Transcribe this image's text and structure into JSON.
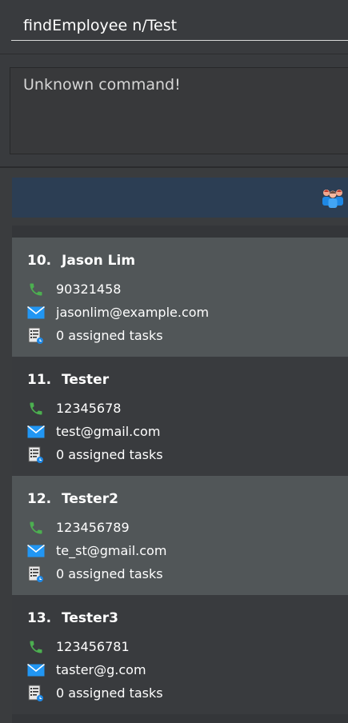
{
  "command_box": {
    "value": "findEmployee n/Test"
  },
  "result_display": {
    "text": "Unknown command!"
  },
  "list_header": {
    "icon": "team-icon"
  },
  "employees": [
    {
      "index": "10.",
      "name": "Jason Lim",
      "phone": "90321458",
      "email": "jasonlim@example.com",
      "tasks": "0 assigned tasks"
    },
    {
      "index": "11.",
      "name": "Tester",
      "phone": "12345678",
      "email": "test@gmail.com",
      "tasks": "0 assigned tasks"
    },
    {
      "index": "12.",
      "name": "Tester2",
      "phone": "123456789",
      "email": "te_st@gmail.com",
      "tasks": "0 assigned tasks"
    },
    {
      "index": "13.",
      "name": "Tester3",
      "phone": "123456781",
      "email": "taster@g.com",
      "tasks": "0 assigned tasks"
    }
  ],
  "colors": {
    "header_bar": "#2c3e54",
    "card_highlight": "#515658",
    "card_plain": "#393b3e",
    "phone_icon": "#4caf50",
    "email_icon": "#2196f3"
  }
}
